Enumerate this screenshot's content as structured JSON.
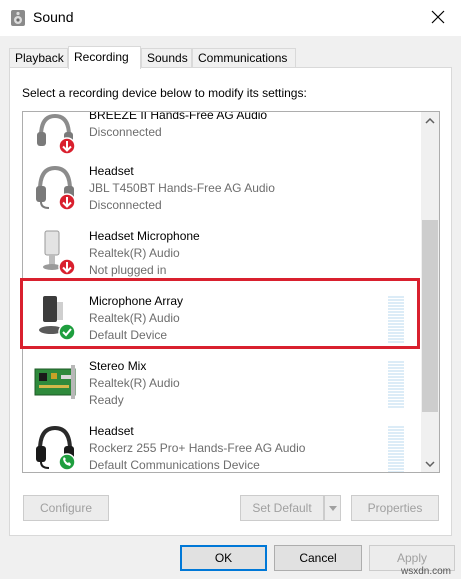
{
  "window": {
    "title": "Sound",
    "title_icon": "speaker-icon",
    "close_icon": "close-icon"
  },
  "tabs": [
    {
      "label": "Playback",
      "active": false
    },
    {
      "label": "Recording",
      "active": true
    },
    {
      "label": "Sounds",
      "active": false
    },
    {
      "label": "Communications",
      "active": false
    }
  ],
  "instruction": "Select a recording device below to modify its settings:",
  "devices": [
    {
      "name": "BREEZE II Hands-Free AG Audio",
      "driver": "",
      "status": "Disconnected",
      "icon": "headset-icon",
      "badge": "red-down-arrow"
    },
    {
      "name": "Headset",
      "driver": "JBL T450BT Hands-Free AG Audio",
      "status": "Disconnected",
      "icon": "headset-icon",
      "badge": "red-down-arrow"
    },
    {
      "name": "Headset Microphone",
      "driver": "Realtek(R) Audio",
      "status": "Not plugged in",
      "icon": "microphone-icon",
      "badge": "red-down-arrow"
    },
    {
      "name": "Microphone Array",
      "driver": "Realtek(R) Audio",
      "status": "Default Device",
      "icon": "microphone-array-icon",
      "badge": "green-check",
      "highlighted": true,
      "level_meter": true
    },
    {
      "name": "Stereo Mix",
      "driver": "Realtek(R) Audio",
      "status": "Ready",
      "icon": "sound-card-icon",
      "level_meter": true
    },
    {
      "name": "Headset",
      "driver": "Rockerz 255 Pro+ Hands-Free AG Audio",
      "status": "Default Communications Device",
      "icon": "headset-icon",
      "badge": "green-phone",
      "level_meter": true
    }
  ],
  "colors": {
    "highlight": "#d9202e",
    "badge_red": "#d9202e",
    "badge_green": "#1e9e3e",
    "meter": "#dcecf7"
  },
  "buttons": {
    "configure": "Configure",
    "set_default": "Set Default",
    "properties": "Properties",
    "ok": "OK",
    "cancel": "Cancel",
    "apply": "Apply"
  },
  "watermark": "wsxdn.com"
}
